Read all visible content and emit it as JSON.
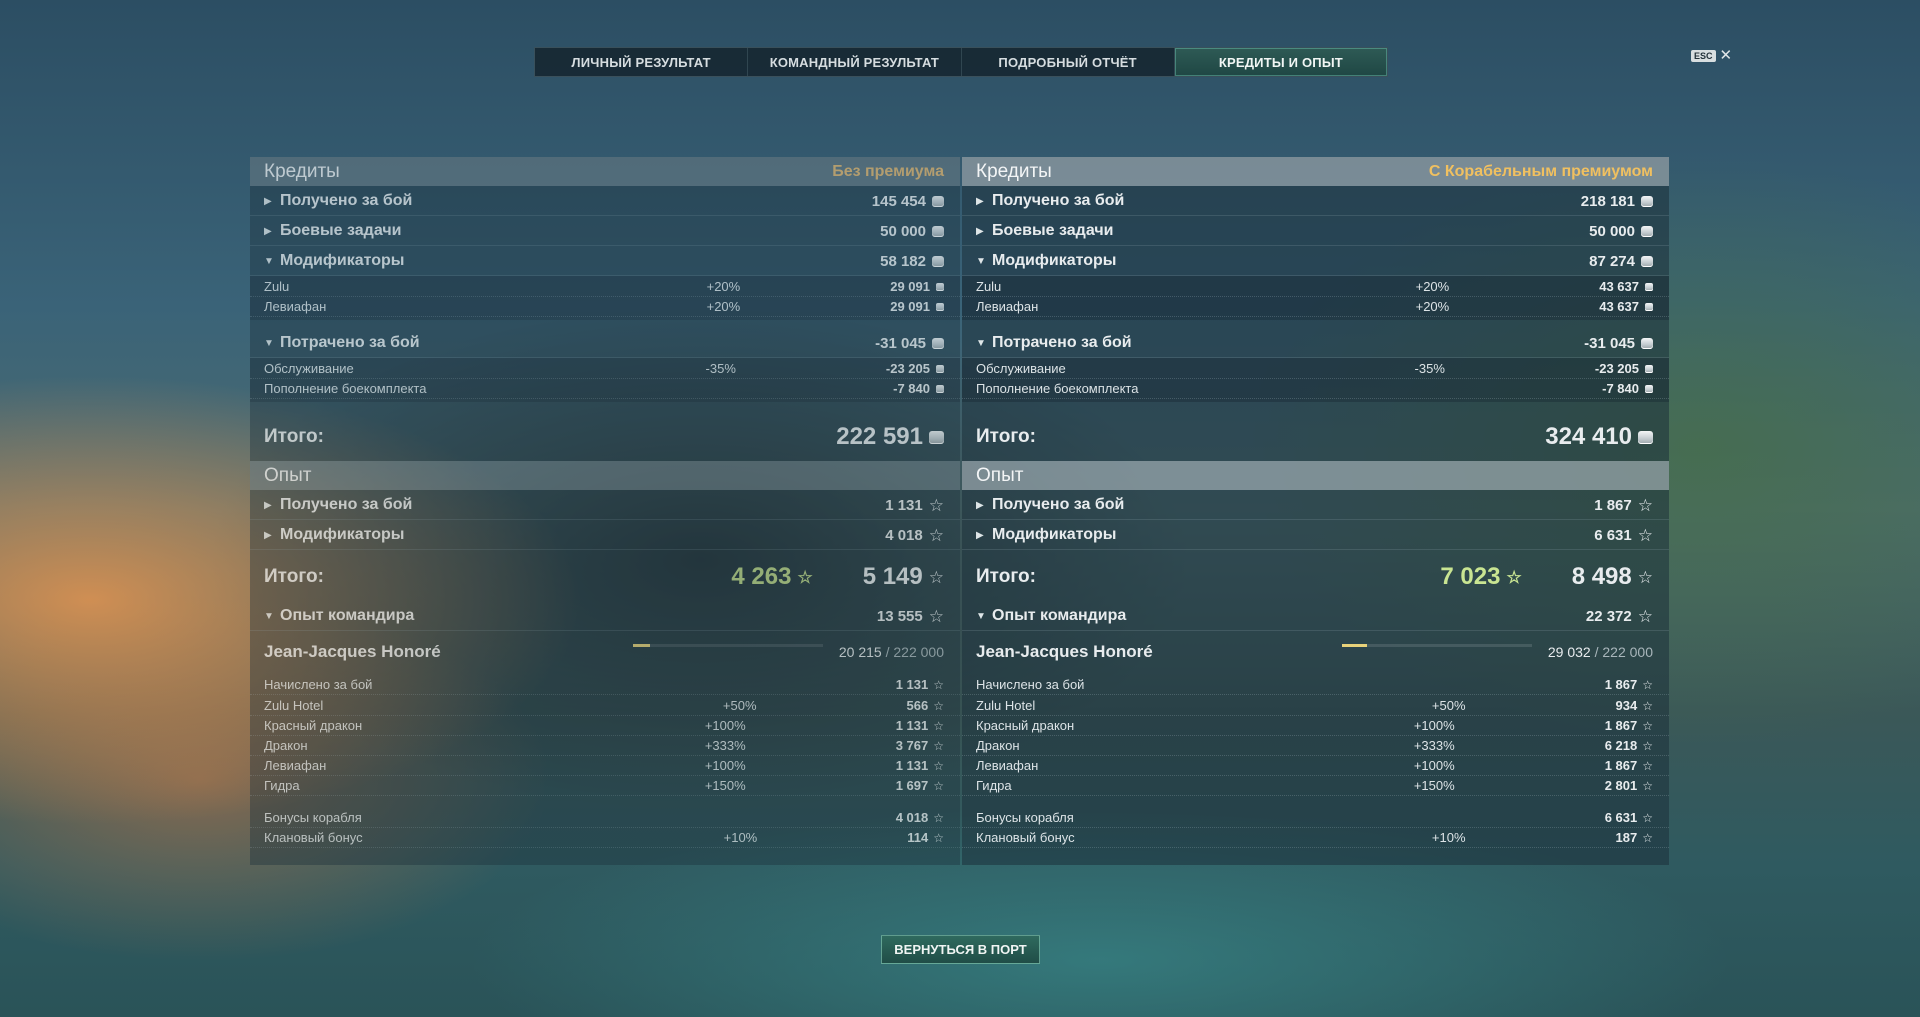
{
  "tabs": [
    {
      "label": "ЛИЧНЫЙ РЕЗУЛЬТАТ"
    },
    {
      "label": "КОМАНДНЫЙ РЕЗУЛЬТАТ"
    },
    {
      "label": "ПОДРОБНЫЙ ОТЧЁТ"
    },
    {
      "label": "КРЕДИТЫ И ОПЫТ"
    }
  ],
  "esc_label": "ESC",
  "close_glyph": "✕",
  "coin_icon": "credit-icon",
  "star_icon": "★",
  "star_outline_icon": "☆",
  "left": {
    "credits_title": "Кредиты",
    "credits_badge": "Без премиума",
    "earned_label": "Получено за бой",
    "earned_value": "145 454",
    "missions_label": "Боевые задачи",
    "missions_value": "50 000",
    "modifiers_label": "Модификаторы",
    "modifiers_value": "58 182",
    "mod1_label": "Zulu",
    "mod1_pct": "+20%",
    "mod1_value": "29 091",
    "mod2_label": "Левиафан",
    "mod2_pct": "+20%",
    "mod2_value": "29 091",
    "spent_label": "Потрачено за бой",
    "spent_value": "-31 045",
    "service_label": "Обслуживание",
    "service_pct": "-35%",
    "service_value": "-23 205",
    "ammo_label": "Пополнение боекомплекта",
    "ammo_value": "-7 840",
    "credits_total_label": "Итого:",
    "credits_total": "222 591",
    "exp_title": "Опыт",
    "exp_earned_label": "Получено за бой",
    "exp_earned_value": "1 131",
    "exp_mod_label": "Модификаторы",
    "exp_mod_value": "4 018",
    "exp_total_label": "Итого:",
    "exp_total_green": "4 263",
    "exp_total": "5 149",
    "cmd_label": "Опыт командира",
    "cmd_value": "13 555",
    "cmd_name": "Jean-Jacques Honoré",
    "cmd_current": "20 215",
    "cmd_max": "/ 222 000",
    "cmd_progress": 0.091,
    "c1_label": "Начислено за бой",
    "c1_pct": "",
    "c1_value": "1 131",
    "c2_label": "Zulu Hotel",
    "c2_pct": "+50%",
    "c2_value": "566",
    "c3_label": "Красный дракон",
    "c3_pct": "+100%",
    "c3_value": "1 131",
    "c4_label": "Дракон",
    "c4_pct": "+333%",
    "c4_value": "3 767",
    "c5_label": "Левиафан",
    "c5_pct": "+100%",
    "c5_value": "1 131",
    "c6_label": "Гидра",
    "c6_pct": "+150%",
    "c6_value": "1 697",
    "c7_label": "Бонусы корабля",
    "c7_pct": "",
    "c7_value": "4 018",
    "c8_label": "Клановый бонус",
    "c8_pct": "+10%",
    "c8_value": "114"
  },
  "right": {
    "credits_title": "Кредиты",
    "credits_badge": "С Корабельным премиумом",
    "earned_label": "Получено за бой",
    "earned_value": "218 181",
    "missions_label": "Боевые задачи",
    "missions_value": "50 000",
    "modifiers_label": "Модификаторы",
    "modifiers_value": "87 274",
    "mod1_label": "Zulu",
    "mod1_pct": "+20%",
    "mod1_value": "43 637",
    "mod2_label": "Левиафан",
    "mod2_pct": "+20%",
    "mod2_value": "43 637",
    "spent_label": "Потрачено за бой",
    "spent_value": "-31 045",
    "service_label": "Обслуживание",
    "service_pct": "-35%",
    "service_value": "-23 205",
    "ammo_label": "Пополнение боекомплекта",
    "ammo_value": "-7 840",
    "credits_total_label": "Итого:",
    "credits_total": "324 410",
    "exp_title": "Опыт",
    "exp_earned_label": "Получено за бой",
    "exp_earned_value": "1 867",
    "exp_mod_label": "Модификаторы",
    "exp_mod_value": "6 631",
    "exp_total_label": "Итого:",
    "exp_total_green": "7 023",
    "exp_total": "8 498",
    "cmd_label": "Опыт командира",
    "cmd_value": "22 372",
    "cmd_name": "Jean-Jacques Honoré",
    "cmd_current": "29 032",
    "cmd_max": "/ 222 000",
    "cmd_progress": 0.131,
    "c1_label": "Начислено за бой",
    "c1_pct": "",
    "c1_value": "1 867",
    "c2_label": "Zulu Hotel",
    "c2_pct": "+50%",
    "c2_value": "934",
    "c3_label": "Красный дракон",
    "c3_pct": "+100%",
    "c3_value": "1 867",
    "c4_label": "Дракон",
    "c4_pct": "+333%",
    "c4_value": "6 218",
    "c5_label": "Левиафан",
    "c5_pct": "+100%",
    "c5_value": "1 867",
    "c6_label": "Гидра",
    "c6_pct": "+150%",
    "c6_value": "2 801",
    "c7_label": "Бонусы корабля",
    "c7_pct": "",
    "c7_value": "6 631",
    "c8_label": "Клановый бонус",
    "c8_pct": "+10%",
    "c8_value": "187"
  },
  "back_button": "ВЕРНУТЬСЯ В ПОРТ",
  "colors": {
    "accent": "#2f6a5e",
    "premium_badge": "#f0c060",
    "green_total": "#c9e592",
    "progress": "#e8d27a"
  }
}
